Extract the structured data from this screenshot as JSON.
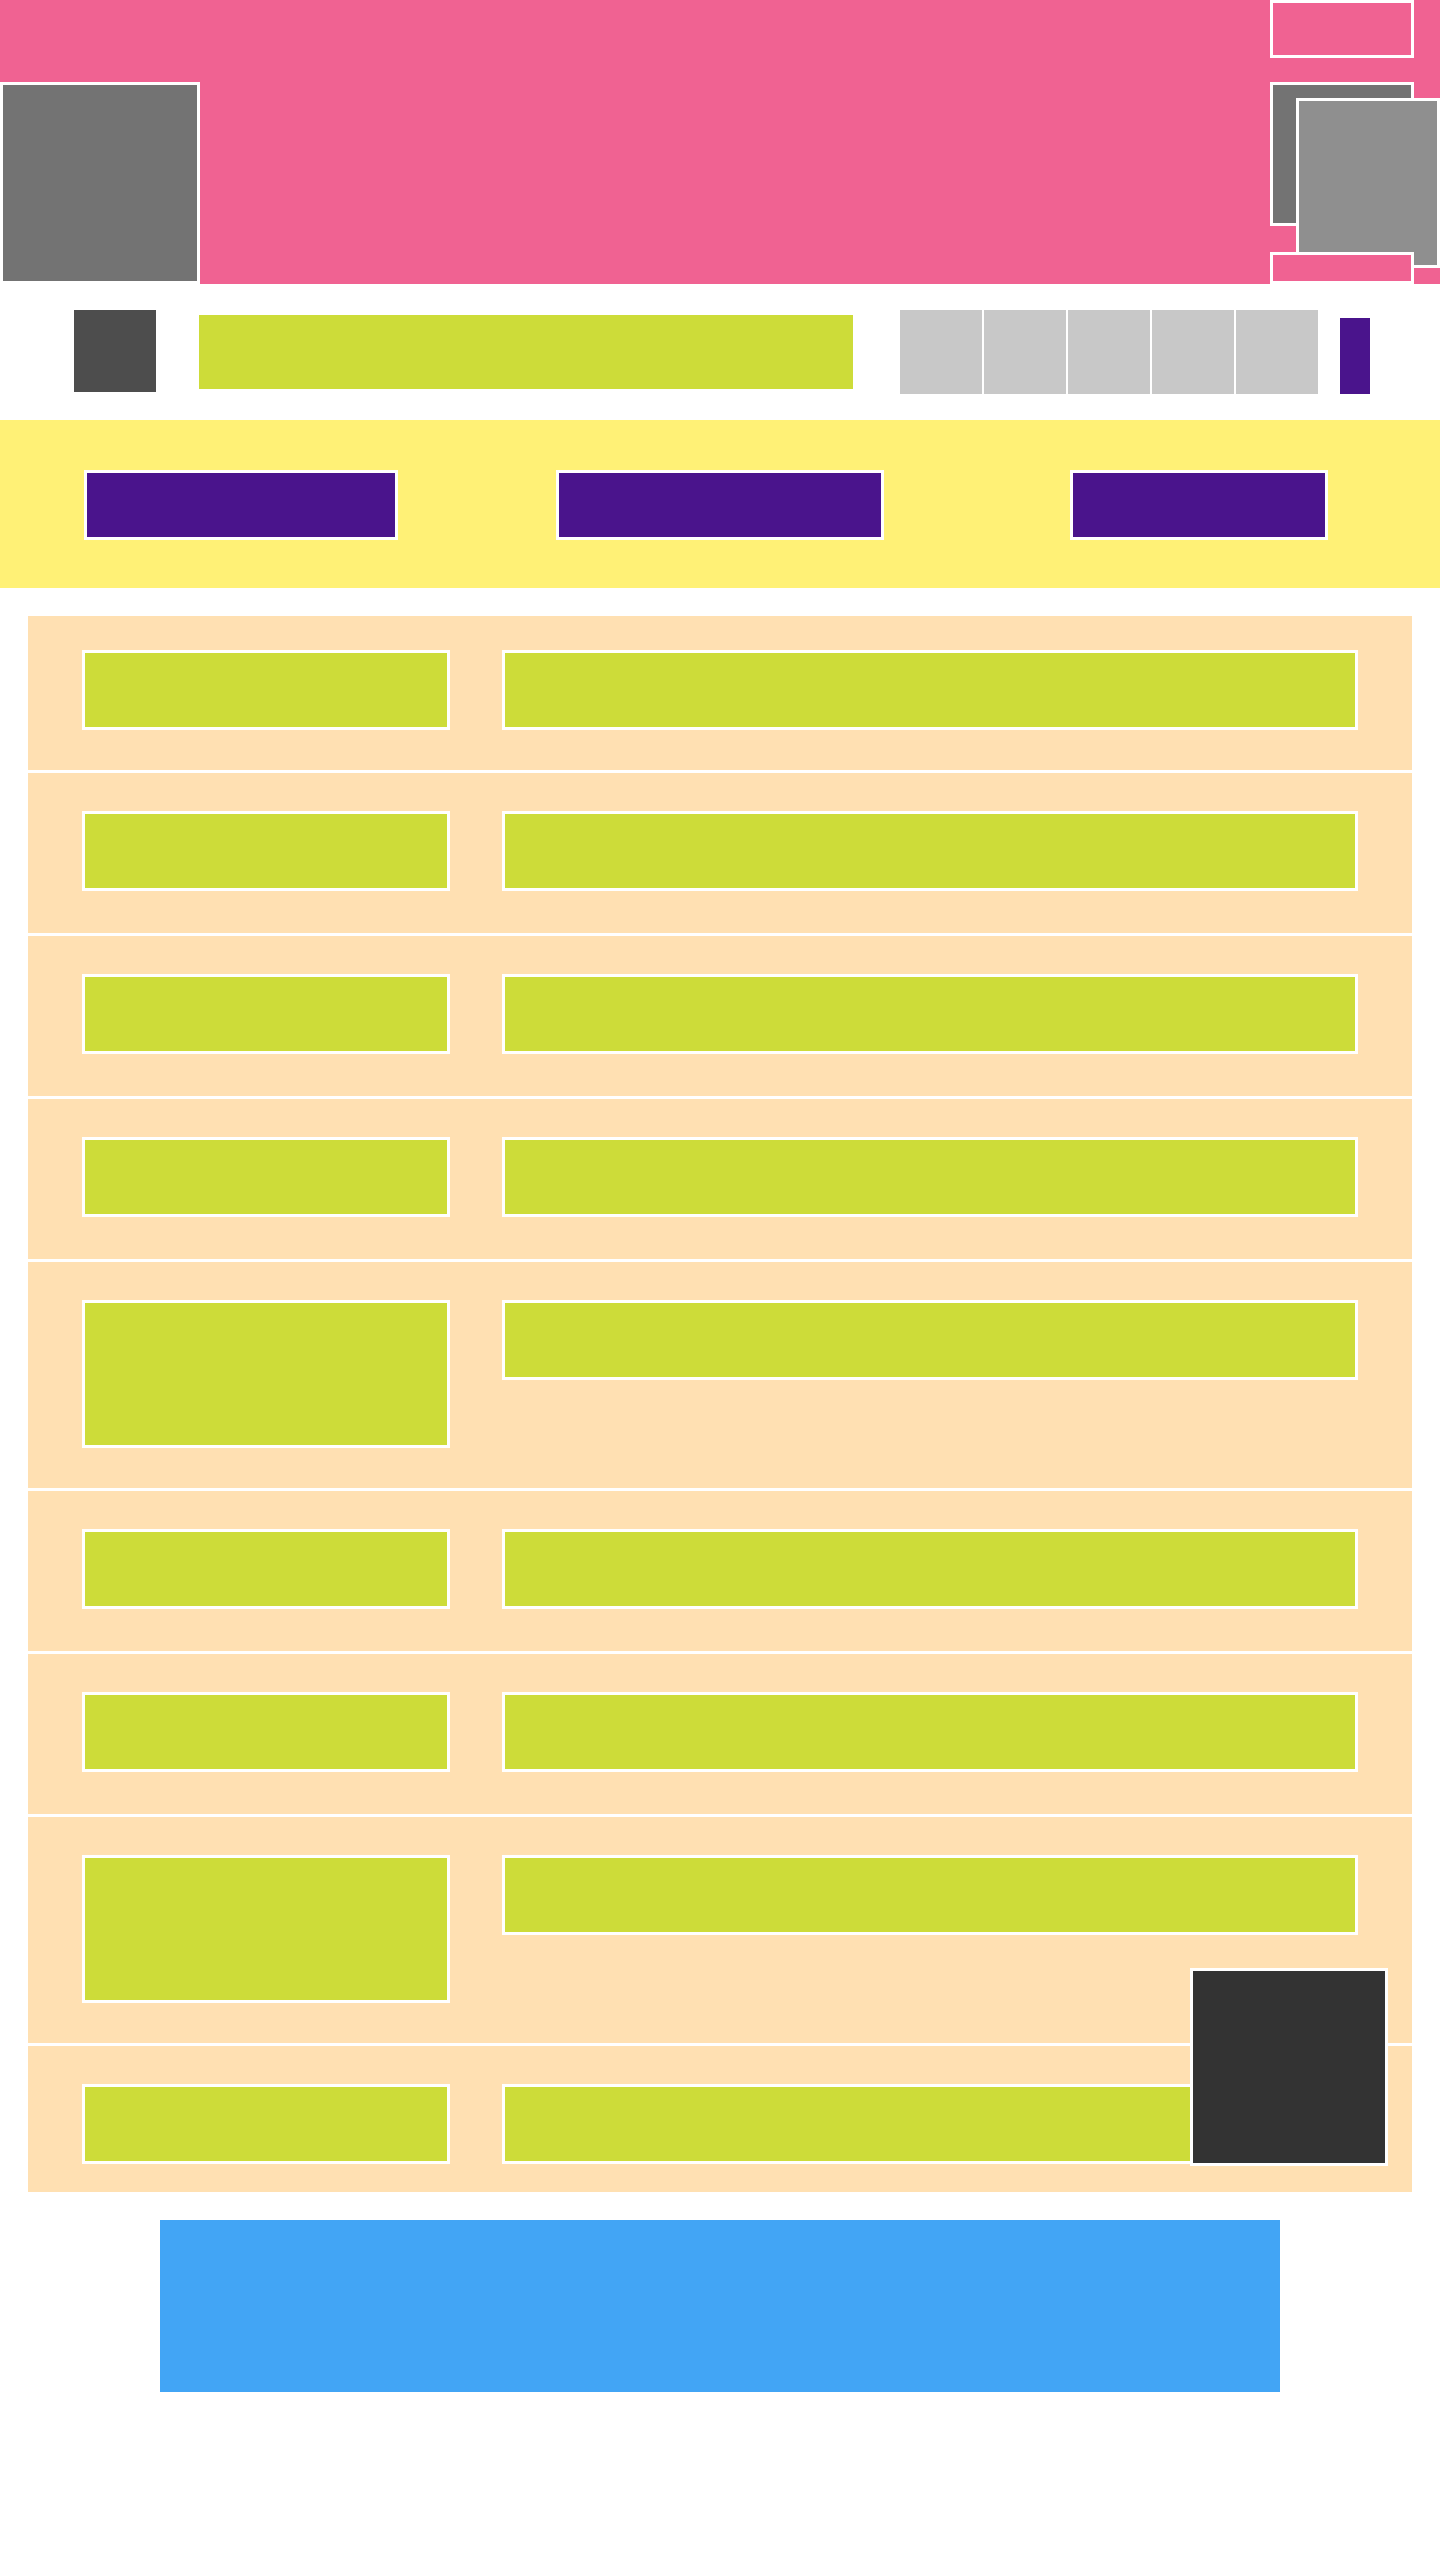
{
  "page": {
    "background": "#ffffff"
  },
  "colors": {
    "header": "#f06292",
    "toolbar_icon": "#4d4d4d",
    "search_bar": "#cddc39",
    "tab_gray": "#c8c8c8",
    "accent_purple": "#4a148c",
    "band_yellow": "#fff176",
    "list_bg": "#ffe0b2",
    "list_field": "#cddc39",
    "cta_blue": "#42a5f5",
    "fab_dark": "#333333"
  },
  "header": {
    "left_image": "",
    "right_images": [
      "",
      "",
      "",
      ""
    ]
  },
  "toolbar": {
    "icon": "menu-icon",
    "search": "",
    "tabs": [
      "",
      "",
      "",
      "",
      ""
    ],
    "indicator": "purple-marker"
  },
  "band": {
    "buttons": [
      "",
      "",
      ""
    ]
  },
  "list": {
    "rows": [
      {
        "label": "",
        "value": ""
      },
      {
        "label": "",
        "value": ""
      },
      {
        "label": "",
        "value": ""
      },
      {
        "label": "",
        "value": ""
      },
      {
        "label": "",
        "value": ""
      },
      {
        "label": "",
        "value": ""
      },
      {
        "label": "",
        "value": ""
      },
      {
        "label": "",
        "value": ""
      },
      {
        "label": "",
        "value": ""
      }
    ]
  },
  "cta": {
    "label": ""
  },
  "fab": {
    "icon": "fab-icon"
  }
}
